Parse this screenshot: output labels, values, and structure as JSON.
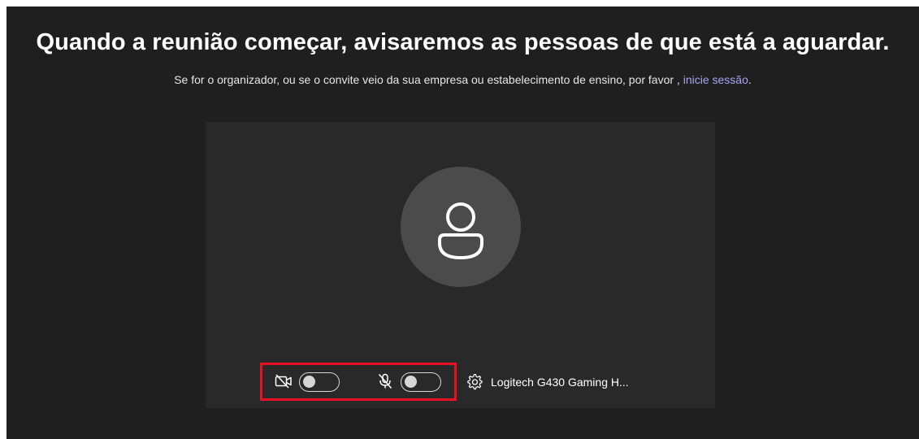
{
  "header": {
    "title": "Quando a reunião começar, avisaremos as pessoas de que está a aguardar.",
    "subtitle_text": "Se for o organizador, ou se o convite veio da sua empresa ou estabelecimento de ensino, por favor",
    "subtitle_separator": " , ",
    "signin_link": "inicie sessão",
    "subtitle_end": "."
  },
  "preview": {
    "avatar_icon": "person-icon",
    "camera_toggle": {
      "icon": "camera-off-icon",
      "on": false
    },
    "mic_toggle": {
      "icon": "mic-off-icon",
      "on": false
    },
    "device": {
      "icon": "gear-icon",
      "label": "Logitech G430 Gaming H..."
    }
  },
  "colors": {
    "background": "#1f1f1f",
    "preview_bg": "#292929",
    "avatar_bg": "#4b4b4b",
    "link": "#a6a6f5",
    "highlight": "#e81123"
  }
}
